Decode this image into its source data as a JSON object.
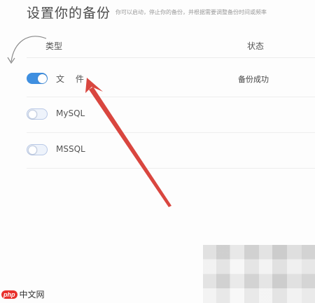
{
  "header": {
    "title": "设置你的备份",
    "subtitle": "你可以启动，停止你的备份，并根据需要调整备份时间或频率"
  },
  "table": {
    "columns": [
      "类型",
      "状态"
    ],
    "rows": [
      {
        "label": "文  件",
        "enabled": true,
        "status": "备份成功"
      },
      {
        "label": "MySQL",
        "enabled": false,
        "status": ""
      },
      {
        "label": "MSSQL",
        "enabled": false,
        "status": ""
      }
    ]
  },
  "colors": {
    "toggle_on": "#3f8fe0",
    "toggle_off": "#eef3fb",
    "annotation_arrow": "#d9463f"
  },
  "watermark": {
    "logo": "php",
    "text": "中文网"
  }
}
